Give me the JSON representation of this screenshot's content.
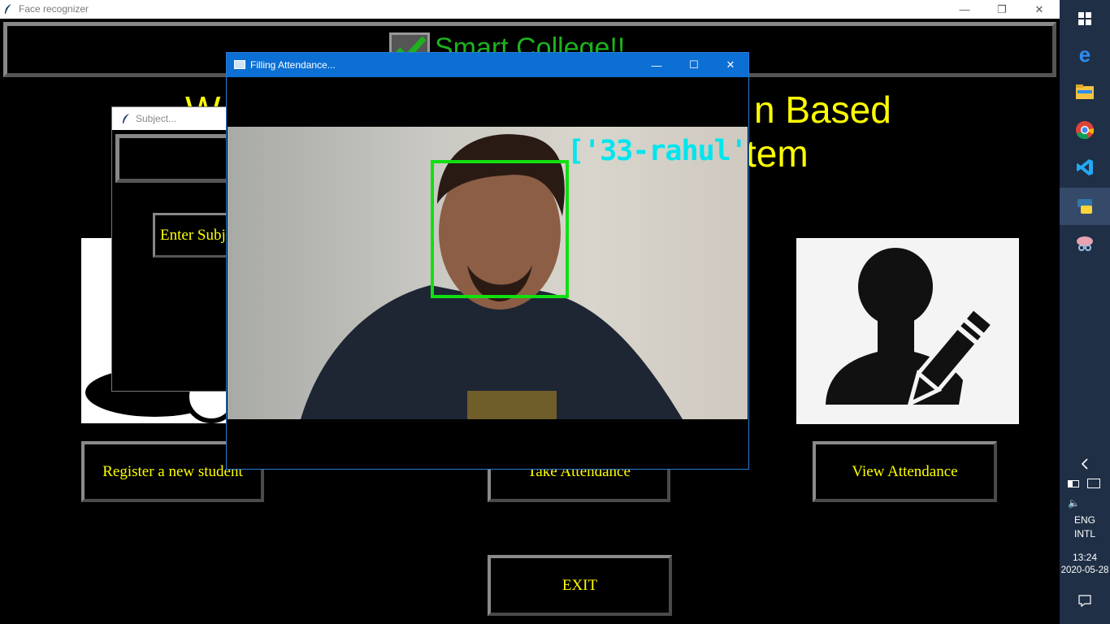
{
  "main_window": {
    "title": "Face recognizer",
    "header_title": "Smart College!!",
    "welcome_line1_left": "W",
    "welcome_line1_right": "n Based",
    "welcome_line2": "tem",
    "buttons": {
      "register": "Register a new student",
      "take_attendance": "Take Attendance",
      "view_attendance": "View Attendance",
      "exit": "EXIT"
    }
  },
  "subject_window": {
    "title": "Subject...",
    "label": "Enter Subj"
  },
  "fill_window": {
    "title": "Filling Attendance...",
    "recognized_label": "['33-rahul']",
    "box_color": "#10e010",
    "label_color": "#00e5ee"
  },
  "taskbar": {
    "icons": [
      "windows-start-icon",
      "edge-icon",
      "file-explorer-icon",
      "chrome-icon",
      "vscode-icon",
      "python-icon",
      "snipping-tool-icon"
    ],
    "lang": "ENG",
    "layout": "INTL",
    "time": "13:24",
    "date": "2020-05-28"
  },
  "colors": {
    "accent_yellow": "#ffff00",
    "header_green": "#1db21d",
    "taskbar_bg": "#1f2f46",
    "dialog_titlebar": "#0b6fd4"
  }
}
